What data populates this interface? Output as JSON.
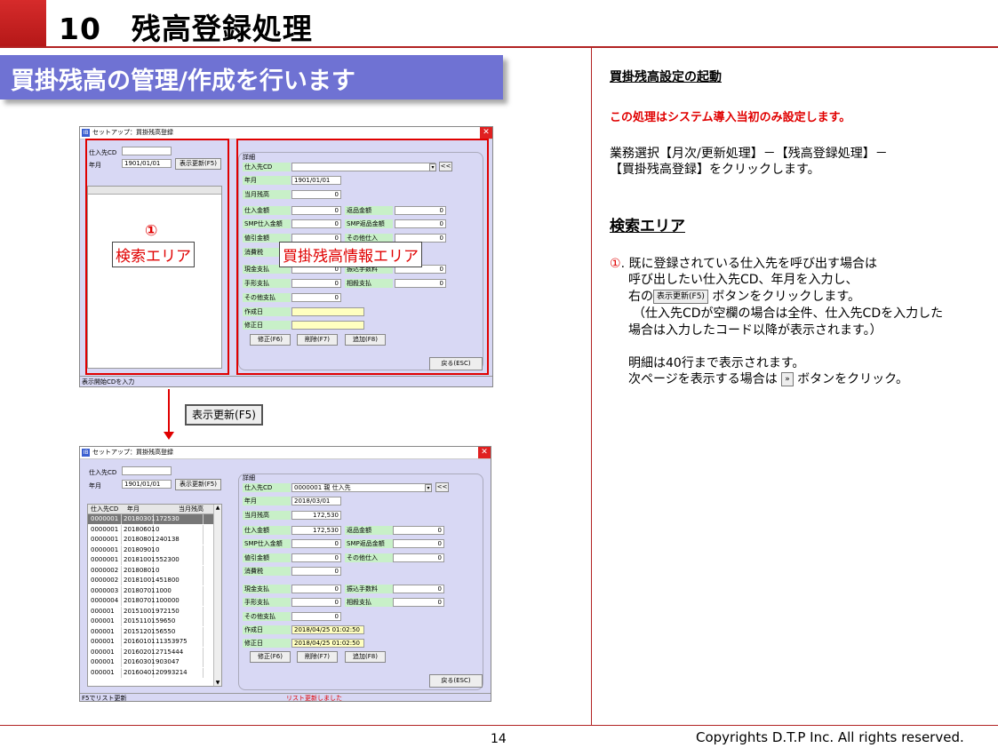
{
  "header": {
    "title": "10　残高登録処理"
  },
  "banner": "買掛残高の管理/作成を行います",
  "footer": {
    "page": "14",
    "copyright": "Copyrights  D.T.P Inc. All rights reserved."
  },
  "right": {
    "h1": "買掛残高設定の起動",
    "notice": "この処理はシステム導入当初のみ設定します。",
    "p1a": "業務選択【月次/更新処理】－【残高登録処理】－",
    "p1b": "【買掛残高登録】をクリックします。",
    "h2": "検索エリア",
    "n1": "①",
    "l1": ". 既に登録されている仕入先を呼び出す場合は",
    "l2": "呼び出したい仕入先CD、年月を入力し、",
    "l3a": "右の",
    "l3b": "ボタンをクリックします。",
    "l4": "（仕入先CDが空欄の場合は全件、仕入先CDを入力した",
    "l5": "場合は入力したコード以降が表示されます。）",
    "l6": "明細は40行まで表示されます。",
    "l7a": "次ページを表示する場合は",
    "l7b": "ボタンをクリック。",
    "btn_refresh": "表示更新(F5)",
    "btn_next": "»"
  },
  "win": {
    "title": "セットアップ：買掛残高登録",
    "close": "✕",
    "app_icon": "IB",
    "lbl_code": "仕入先CD",
    "lbl_ym": "年月",
    "ym_value": "1901/01/01",
    "refresh": "表示更新(F5)",
    "detail": "詳細",
    "f_code": "仕入先CD",
    "f_ym": "年月",
    "f_bal": "当月残高",
    "f_buy": "仕入金額",
    "f_smpbuy": "SMP仕入金額",
    "f_disc": "値引金額",
    "f_tax": "消費税",
    "f_cash": "現金支払",
    "f_bill": "手形支払",
    "f_other": "その他支払",
    "f_created": "作成日",
    "f_modified": "修正日",
    "f_ret": "返品金額",
    "f_smpret": "SMP返品金額",
    "f_othbuy": "その他仕入",
    "f_fee": "振込手数料",
    "f_offset": "相殺支払",
    "zero": "0",
    "nav": "<<",
    "btn_edit": "修正(F6)",
    "btn_del": "削除(F7)",
    "btn_add": "追加(F8)",
    "btn_back": "戻る(ESC)",
    "col_code": "仕入先CD",
    "col_ym": "年月",
    "col_bal": "当月残高"
  },
  "win1": {
    "status": "表示開始CDを入力"
  },
  "callouts": {
    "num": "①",
    "search": "検索エリア",
    "info": "買掛残高情報エリア"
  },
  "mid_button": "表示更新(F5)",
  "win2": {
    "code_value": "0000001 親  仕入先",
    "ym_value": "2018/03/01",
    "bal": "172,530",
    "buy": "172,530",
    "created": "2018/04/25 01:02:50",
    "modified": "2018/04/25 01:02:50",
    "status1": "F5でリスト更新",
    "status2": "リスト更新しました",
    "rows": [
      [
        "0000001",
        "20180301",
        "172530"
      ],
      [
        "0000001",
        "20180601",
        "0"
      ],
      [
        "0000001",
        "20180801",
        "240138"
      ],
      [
        "0000001",
        "20180901",
        "0"
      ],
      [
        "0000001",
        "20181001",
        "552300"
      ],
      [
        "0000002",
        "20180801",
        "0"
      ],
      [
        "0000002",
        "20181001",
        "451800"
      ],
      [
        "0000003",
        "20180701",
        "1000"
      ],
      [
        "0000004",
        "20180701",
        "100000"
      ],
      [
        "000001",
        "20151001",
        "972150"
      ],
      [
        "000001",
        "20151101",
        "59650"
      ],
      [
        "000001",
        "20151201",
        "56550"
      ],
      [
        "000001",
        "20160101",
        "11353975"
      ],
      [
        "000001",
        "20160201",
        "2715444"
      ],
      [
        "000001",
        "20160301",
        "903047"
      ],
      [
        "000001",
        "20160401",
        "20993214"
      ]
    ]
  },
  "colors": {
    "accent": "#b22222",
    "banner": "#6f72d3",
    "window": "#d8d8f4",
    "highlight": "#e00000"
  }
}
